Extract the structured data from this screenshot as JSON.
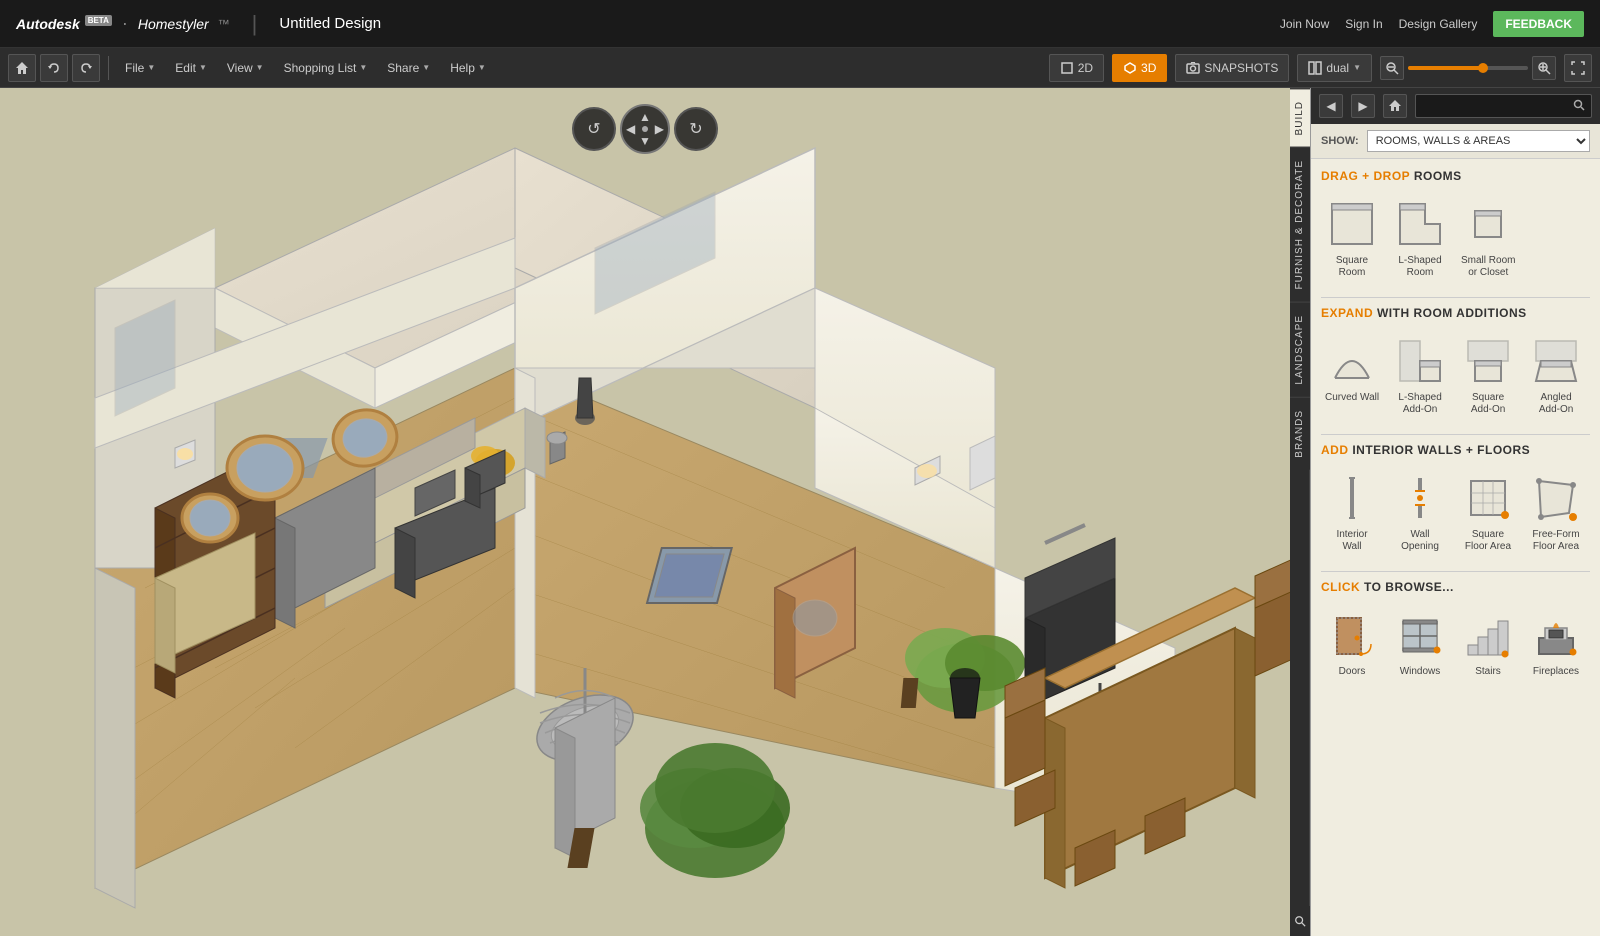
{
  "app": {
    "name": "Autodesk",
    "product": "Homestyler",
    "beta": "BETA",
    "design_title": "Untitled Design"
  },
  "top_nav": {
    "join_now": "Join Now",
    "sign_in": "Sign In",
    "design_gallery": "Design Gallery",
    "feedback": "FEEDBACK"
  },
  "toolbar": {
    "file": "File",
    "edit": "Edit",
    "view": "View",
    "shopping_list": "Shopping List",
    "share": "Share",
    "help": "Help",
    "view_2d": "2D",
    "view_3d": "3D",
    "snapshots": "SNAPSHOTS",
    "dual": "dual"
  },
  "panel": {
    "tabs": [
      "BUILD",
      "FURNISH & DECORATE",
      "LANDSCAPE",
      "BRANDS"
    ],
    "active_tab": "BUILD",
    "show_label": "SHOW:",
    "show_value": "ROOMS, WALLS & AREAS",
    "search_placeholder": ""
  },
  "drag_drop_rooms": {
    "title_accent": "DRAG + DROP",
    "title_normal": "ROOMS",
    "items": [
      {
        "id": "square-room",
        "label": "Square\nRoom"
      },
      {
        "id": "l-shaped-room",
        "label": "L-Shaped\nRoom"
      },
      {
        "id": "small-room-closet",
        "label": "Small Room\nor Closet"
      }
    ]
  },
  "room_additions": {
    "title_accent": "EXPAND",
    "title_normal": "WITH ROOM ADDITIONS",
    "items": [
      {
        "id": "curved-wall",
        "label": "Curved Wall"
      },
      {
        "id": "l-shaped-addon",
        "label": "L-Shaped\nAdd-On"
      },
      {
        "id": "square-addon",
        "label": "Square\nAdd-On"
      },
      {
        "id": "angled-addon",
        "label": "Angled\nAdd-On"
      }
    ]
  },
  "interior_walls": {
    "title_accent": "ADD",
    "title_normal": "INTERIOR WALLS + FLOORS",
    "items": [
      {
        "id": "interior-wall",
        "label": "Interior\nWall"
      },
      {
        "id": "wall-opening",
        "label": "Wall\nOpening"
      },
      {
        "id": "square-floor-area",
        "label": "Square\nFloor Area"
      },
      {
        "id": "free-form-floor",
        "label": "Free-Form\nFloor Area"
      }
    ]
  },
  "browse": {
    "title_accent": "CLICK",
    "title_normal": "TO BROWSE...",
    "items": [
      {
        "id": "doors",
        "label": "Doors"
      },
      {
        "id": "windows",
        "label": "Windows"
      },
      {
        "id": "stairs",
        "label": "Stairs"
      },
      {
        "id": "fireplaces",
        "label": "Fireplaces"
      }
    ]
  },
  "nav_controls": {
    "rotate_left": "↺",
    "rotate_right": "↻",
    "arrow_up": "▲",
    "arrow_down": "▼",
    "arrow_left": "◀",
    "arrow_right": "▶"
  },
  "colors": {
    "accent": "#e67e00",
    "background_dark": "#1a1a1a",
    "toolbar_bg": "#2d2d2d",
    "panel_bg": "#f0ede0",
    "viewport_bg": "#c8c4a8",
    "active_green": "#5cb85c"
  }
}
